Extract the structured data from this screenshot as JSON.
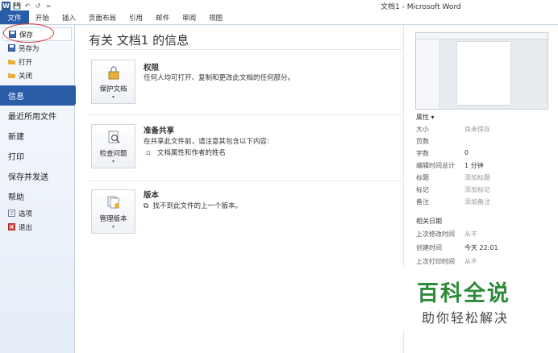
{
  "window": {
    "title": "文档1 - Microsoft Word",
    "app_icon_letter": "W"
  },
  "quick_access": {
    "save": "💾",
    "undo": "↶",
    "redo": "↺",
    "customize": "="
  },
  "menubar": {
    "tabs": [
      "文件",
      "开始",
      "插入",
      "页面布局",
      "引用",
      "邮件",
      "审阅",
      "视图"
    ]
  },
  "sidebar": {
    "small_items": [
      {
        "label": "保存",
        "icon": "save-icon"
      },
      {
        "label": "另存为",
        "icon": "save-as-icon"
      },
      {
        "label": "打开",
        "icon": "folder-open-icon"
      },
      {
        "label": "关闭",
        "icon": "folder-close-icon"
      }
    ],
    "info": "信息",
    "recent": "最近所用文件",
    "new": "新建",
    "print": "打印",
    "save_send": "保存并发送",
    "help": "帮助",
    "options": "选项",
    "exit": "退出"
  },
  "main": {
    "title": "有关 文档1 的信息",
    "permissions": {
      "button": "保护文档",
      "title": "权限",
      "desc": "任何人均可打开、复制和更改此文档的任何部分。"
    },
    "prepare": {
      "button": "检查问题",
      "title": "准备共享",
      "desc": "在共享此文件前，请注意其包含以下内容:",
      "bullet": "文档属性和作者的姓名"
    },
    "versions": {
      "button": "管理版本",
      "title": "版本",
      "desc": "找不到此文件的上一个版本。"
    }
  },
  "properties": {
    "header": "属性 ▾",
    "rows": [
      {
        "key": "大小",
        "value": "尚未保存"
      },
      {
        "key": "页数",
        "value": ""
      },
      {
        "key": "字数",
        "value": "0"
      },
      {
        "key": "编辑时间总计",
        "value": "1 分钟"
      },
      {
        "key": "标题",
        "value": "添加标题"
      },
      {
        "key": "标记",
        "value": "添加标记"
      },
      {
        "key": "备注",
        "value": "添加备注"
      }
    ],
    "dates_header": "相关日期",
    "dates": [
      {
        "key": "上次修改时间",
        "value": "从不"
      },
      {
        "key": "创建时间",
        "value": "今天 22:01"
      },
      {
        "key": "上次打印时间",
        "value": "从不"
      }
    ]
  },
  "watermark": {
    "line1": "百科全说",
    "line2": "助你轻松解决"
  },
  "colors": {
    "file_tab": "#2a5da8",
    "watermark_green": "#2e8b3a",
    "annotation_red": "#d23b3b"
  }
}
